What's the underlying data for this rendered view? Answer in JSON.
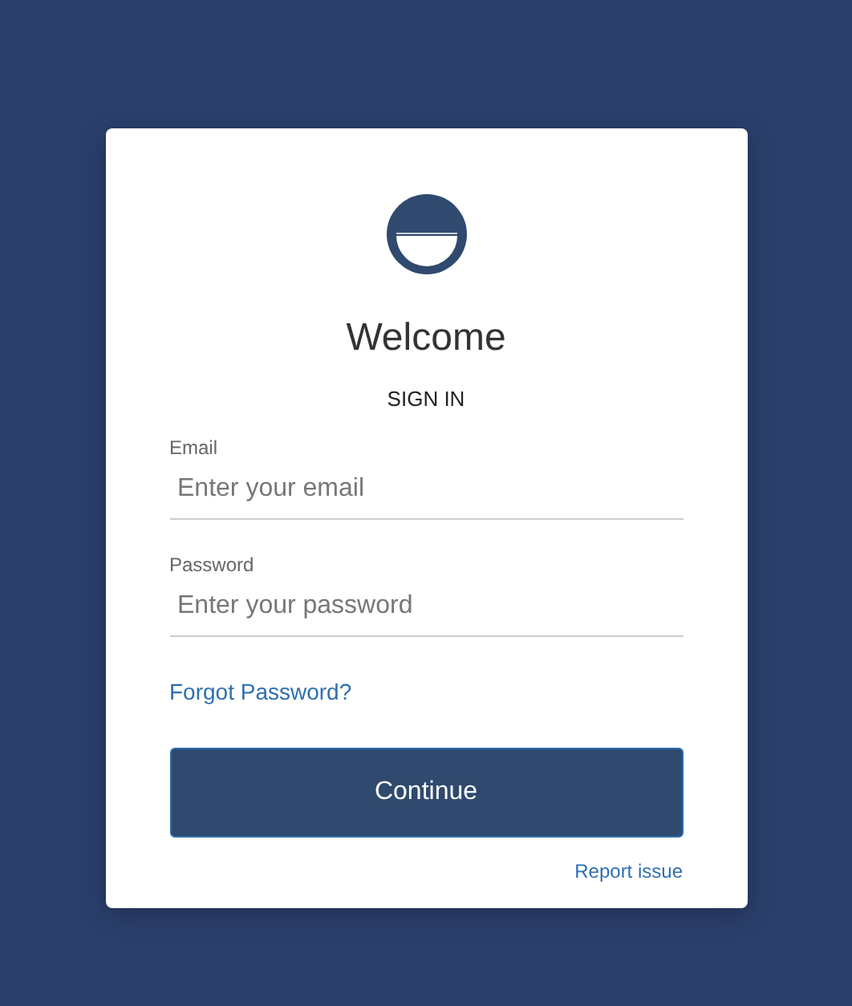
{
  "heading": "Welcome",
  "subheading": "SIGN IN",
  "fields": [
    {
      "label": "Email",
      "placeholder": "Enter your email"
    },
    {
      "label": "Password",
      "placeholder": "Enter your password"
    }
  ],
  "forgot_link": "Forgot Password?",
  "submit_button": "Continue",
  "report_link": "Report issue"
}
